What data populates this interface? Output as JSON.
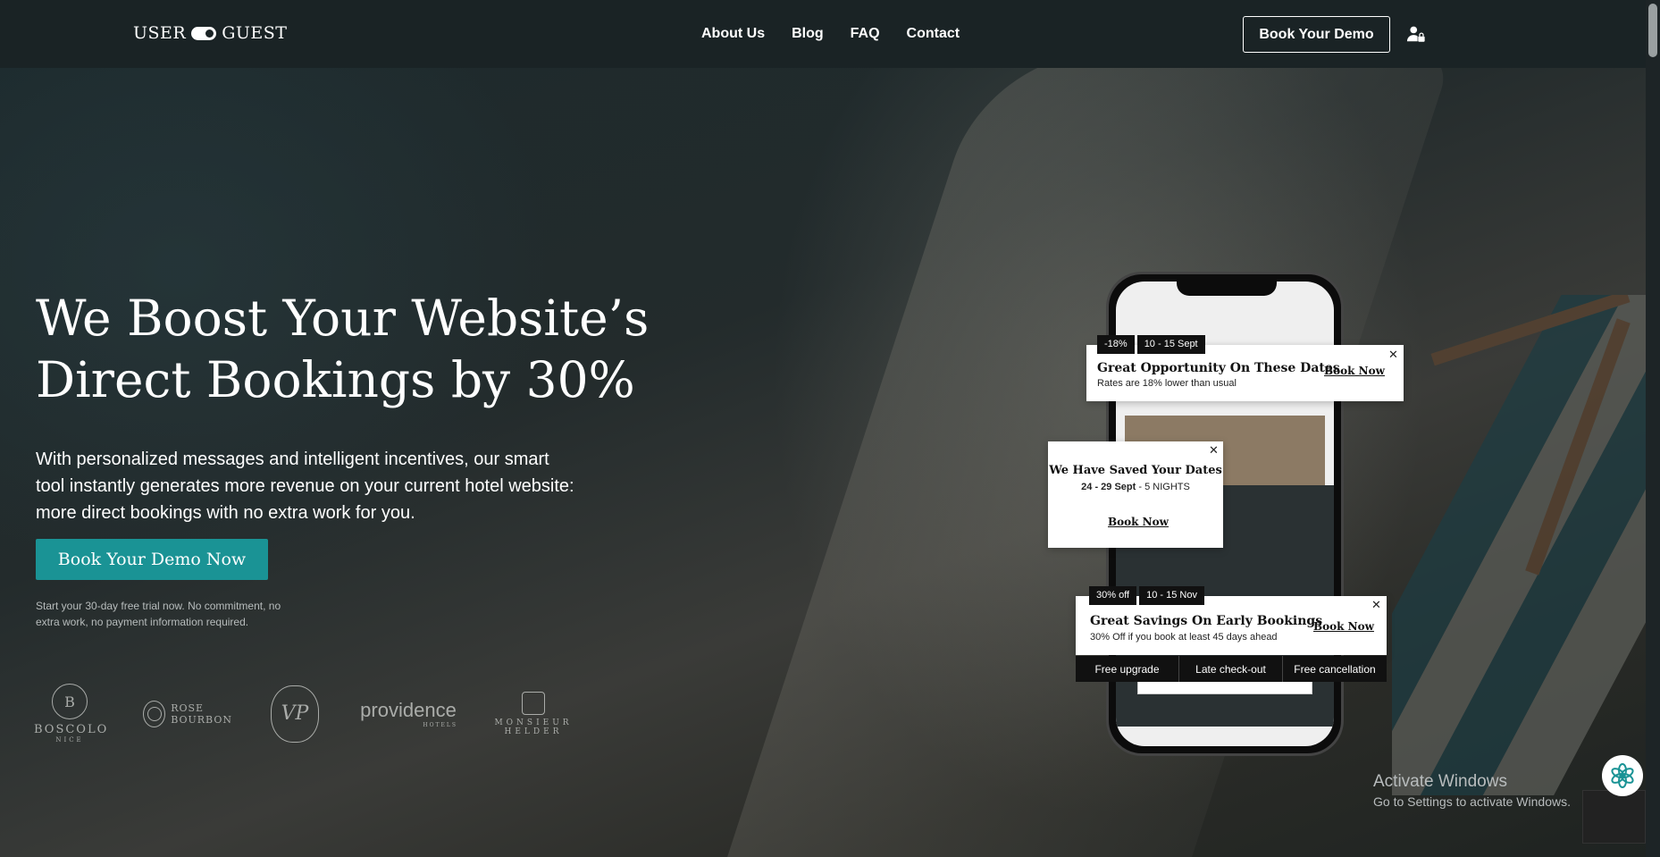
{
  "brand": {
    "left": "USER",
    "right": "GUEST"
  },
  "nav": [
    "About Us",
    "Blog",
    "FAQ",
    "Contact"
  ],
  "header_cta": "Book Your Demo",
  "hero": {
    "title_line1": "We Boost Your Website’s",
    "title_line2": "Direct Bookings by 30%",
    "subtitle": "With personalized messages and intelligent incentives, our smart tool instantly generates more revenue on your current hotel website: more direct bookings with no extra work for you.",
    "cta": "Book Your Demo Now",
    "trial_note": "Start your 30-day free trial now. No commitment, no extra work, no payment information required."
  },
  "partner_logos": [
    {
      "name": "BOSCOLO",
      "sub": "NICE",
      "mark": "B"
    },
    {
      "name": "ROSE",
      "sub": "BOURBON",
      "mark": ""
    },
    {
      "name": "VP",
      "sub": "",
      "mark": "VP"
    },
    {
      "name": "providence",
      "sub": "HOTELS",
      "mark": ""
    },
    {
      "name": "MONSIEUR",
      "sub": "HELDER",
      "mark": ""
    }
  ],
  "cards": {
    "opportunity": {
      "tags": [
        "-18%",
        "10 - 15 Sept"
      ],
      "title": "Great Opportunity On These Dates",
      "text": "Rates are 18% lower than usual",
      "link": "Book Now",
      "close": "✕"
    },
    "saved": {
      "title": "We Have Saved Your Dates",
      "dates": "24 - 29 Sept",
      "sep": " - ",
      "nights": "5 NIGHTS",
      "link": "Book Now",
      "close": "✕"
    },
    "savings": {
      "tags": [
        "30% off",
        "10 - 15 Nov"
      ],
      "title": "Great Savings On Early Bookings",
      "text": "30% Off if you book at least 45 days ahead",
      "link": "Book Now",
      "close": "✕",
      "perks": [
        "Free upgrade",
        "Late check-out",
        "Free cancellation"
      ]
    }
  },
  "windows_notice": {
    "title": "Activate Windows",
    "subtitle": "Go to Settings to activate Windows."
  },
  "colors": {
    "accent": "#1a9395",
    "header_bg": "#1a2325"
  }
}
